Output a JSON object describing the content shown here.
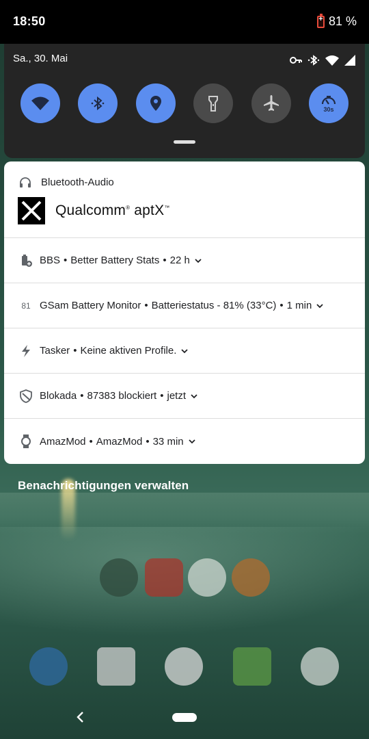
{
  "status_bar": {
    "time": "18:50",
    "battery": "81 %"
  },
  "quick_settings": {
    "date": "Sa., 30. Mai",
    "tiles": [
      {
        "name": "wifi",
        "state": "on"
      },
      {
        "name": "bluetooth",
        "state": "on"
      },
      {
        "name": "location",
        "state": "on"
      },
      {
        "name": "flashlight",
        "state": "off"
      },
      {
        "name": "airplane",
        "state": "off"
      },
      {
        "name": "screen-timeout",
        "state": "on",
        "label": "30s"
      }
    ]
  },
  "notifications": {
    "bluetooth": {
      "title": "Bluetooth-Audio",
      "brand": "Qualcomm",
      "brand_suffix": "aptX"
    },
    "rows": [
      {
        "app": "BBS",
        "text": "Better Battery Stats",
        "time": "22 h"
      },
      {
        "app": "GSam Battery Monitor",
        "icon_text": "81",
        "text": "Batteriestatus - 81% (33°C)",
        "time": "1 min"
      },
      {
        "app": "Tasker",
        "text": "Keine aktiven Profile."
      },
      {
        "app": "Blokada",
        "text": "87383 blockiert",
        "time": "jetzt"
      },
      {
        "app": "AmazMod",
        "text": "AmazMod",
        "time": "33 min"
      }
    ]
  },
  "manage_label": "Benachrichtigungen verwalten",
  "colors": {
    "accent": "#5b8def",
    "tile_off": "#4a4a4a",
    "panel": "#252525"
  }
}
